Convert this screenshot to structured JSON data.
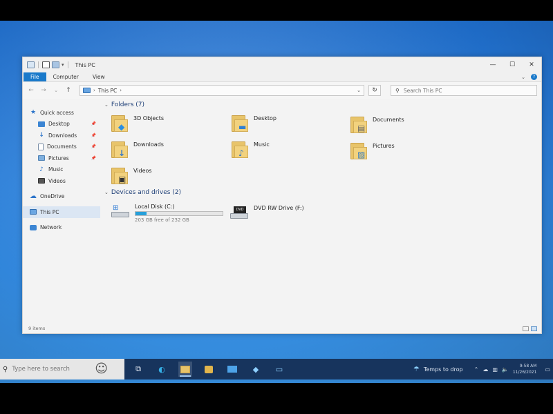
{
  "window": {
    "title": "This PC",
    "ribbon_tabs": [
      "File",
      "Computer",
      "View"
    ],
    "minimize": "—",
    "maximize": "☐",
    "close": "✕"
  },
  "address": {
    "crumb": "This PC",
    "sep": "›",
    "dropdown": "⌄",
    "refresh": "↻"
  },
  "search": {
    "placeholder": "Search This PC"
  },
  "sidebar": {
    "quick_access": "Quick access",
    "items": [
      {
        "label": "Desktop",
        "icon": "desktop-icon",
        "pinned": true
      },
      {
        "label": "Downloads",
        "icon": "downloads-icon",
        "pinned": true
      },
      {
        "label": "Documents",
        "icon": "documents-icon",
        "pinned": true
      },
      {
        "label": "Pictures",
        "icon": "pictures-icon",
        "pinned": true
      },
      {
        "label": "Music",
        "icon": "music-icon",
        "pinned": false
      },
      {
        "label": "Videos",
        "icon": "videos-icon",
        "pinned": false
      }
    ],
    "onedrive": "OneDrive",
    "this_pc": "This PC",
    "network": "Network"
  },
  "content": {
    "folders_header": "Folders (7)",
    "folders": [
      {
        "label": "3D Objects",
        "icon": "3d-objects-icon"
      },
      {
        "label": "Desktop",
        "icon": "desktop-folder-icon"
      },
      {
        "label": "Documents",
        "icon": "documents-folder-icon"
      },
      {
        "label": "Downloads",
        "icon": "downloads-folder-icon"
      },
      {
        "label": "Music",
        "icon": "music-folder-icon"
      },
      {
        "label": "Pictures",
        "icon": "pictures-folder-icon"
      },
      {
        "label": "Videos",
        "icon": "videos-folder-icon"
      }
    ],
    "drives_header": "Devices and drives (2)",
    "drives": [
      {
        "label": "Local Disk (C:)",
        "free_text": "203 GB free of 232 GB",
        "used_fraction": 0.125
      },
      {
        "label": "DVD RW Drive (F:)"
      }
    ]
  },
  "status": {
    "items": "9 items"
  },
  "taskbar": {
    "search_placeholder": "Type here to search",
    "weather": "Temps to drop",
    "clock_time": "9:58 AM",
    "clock_date": "11/26/2021"
  },
  "colors": {
    "accent": "#1979ca",
    "taskbar": "#17345d",
    "folder": "#e8c46a",
    "drive_bar": "#26a0da"
  }
}
